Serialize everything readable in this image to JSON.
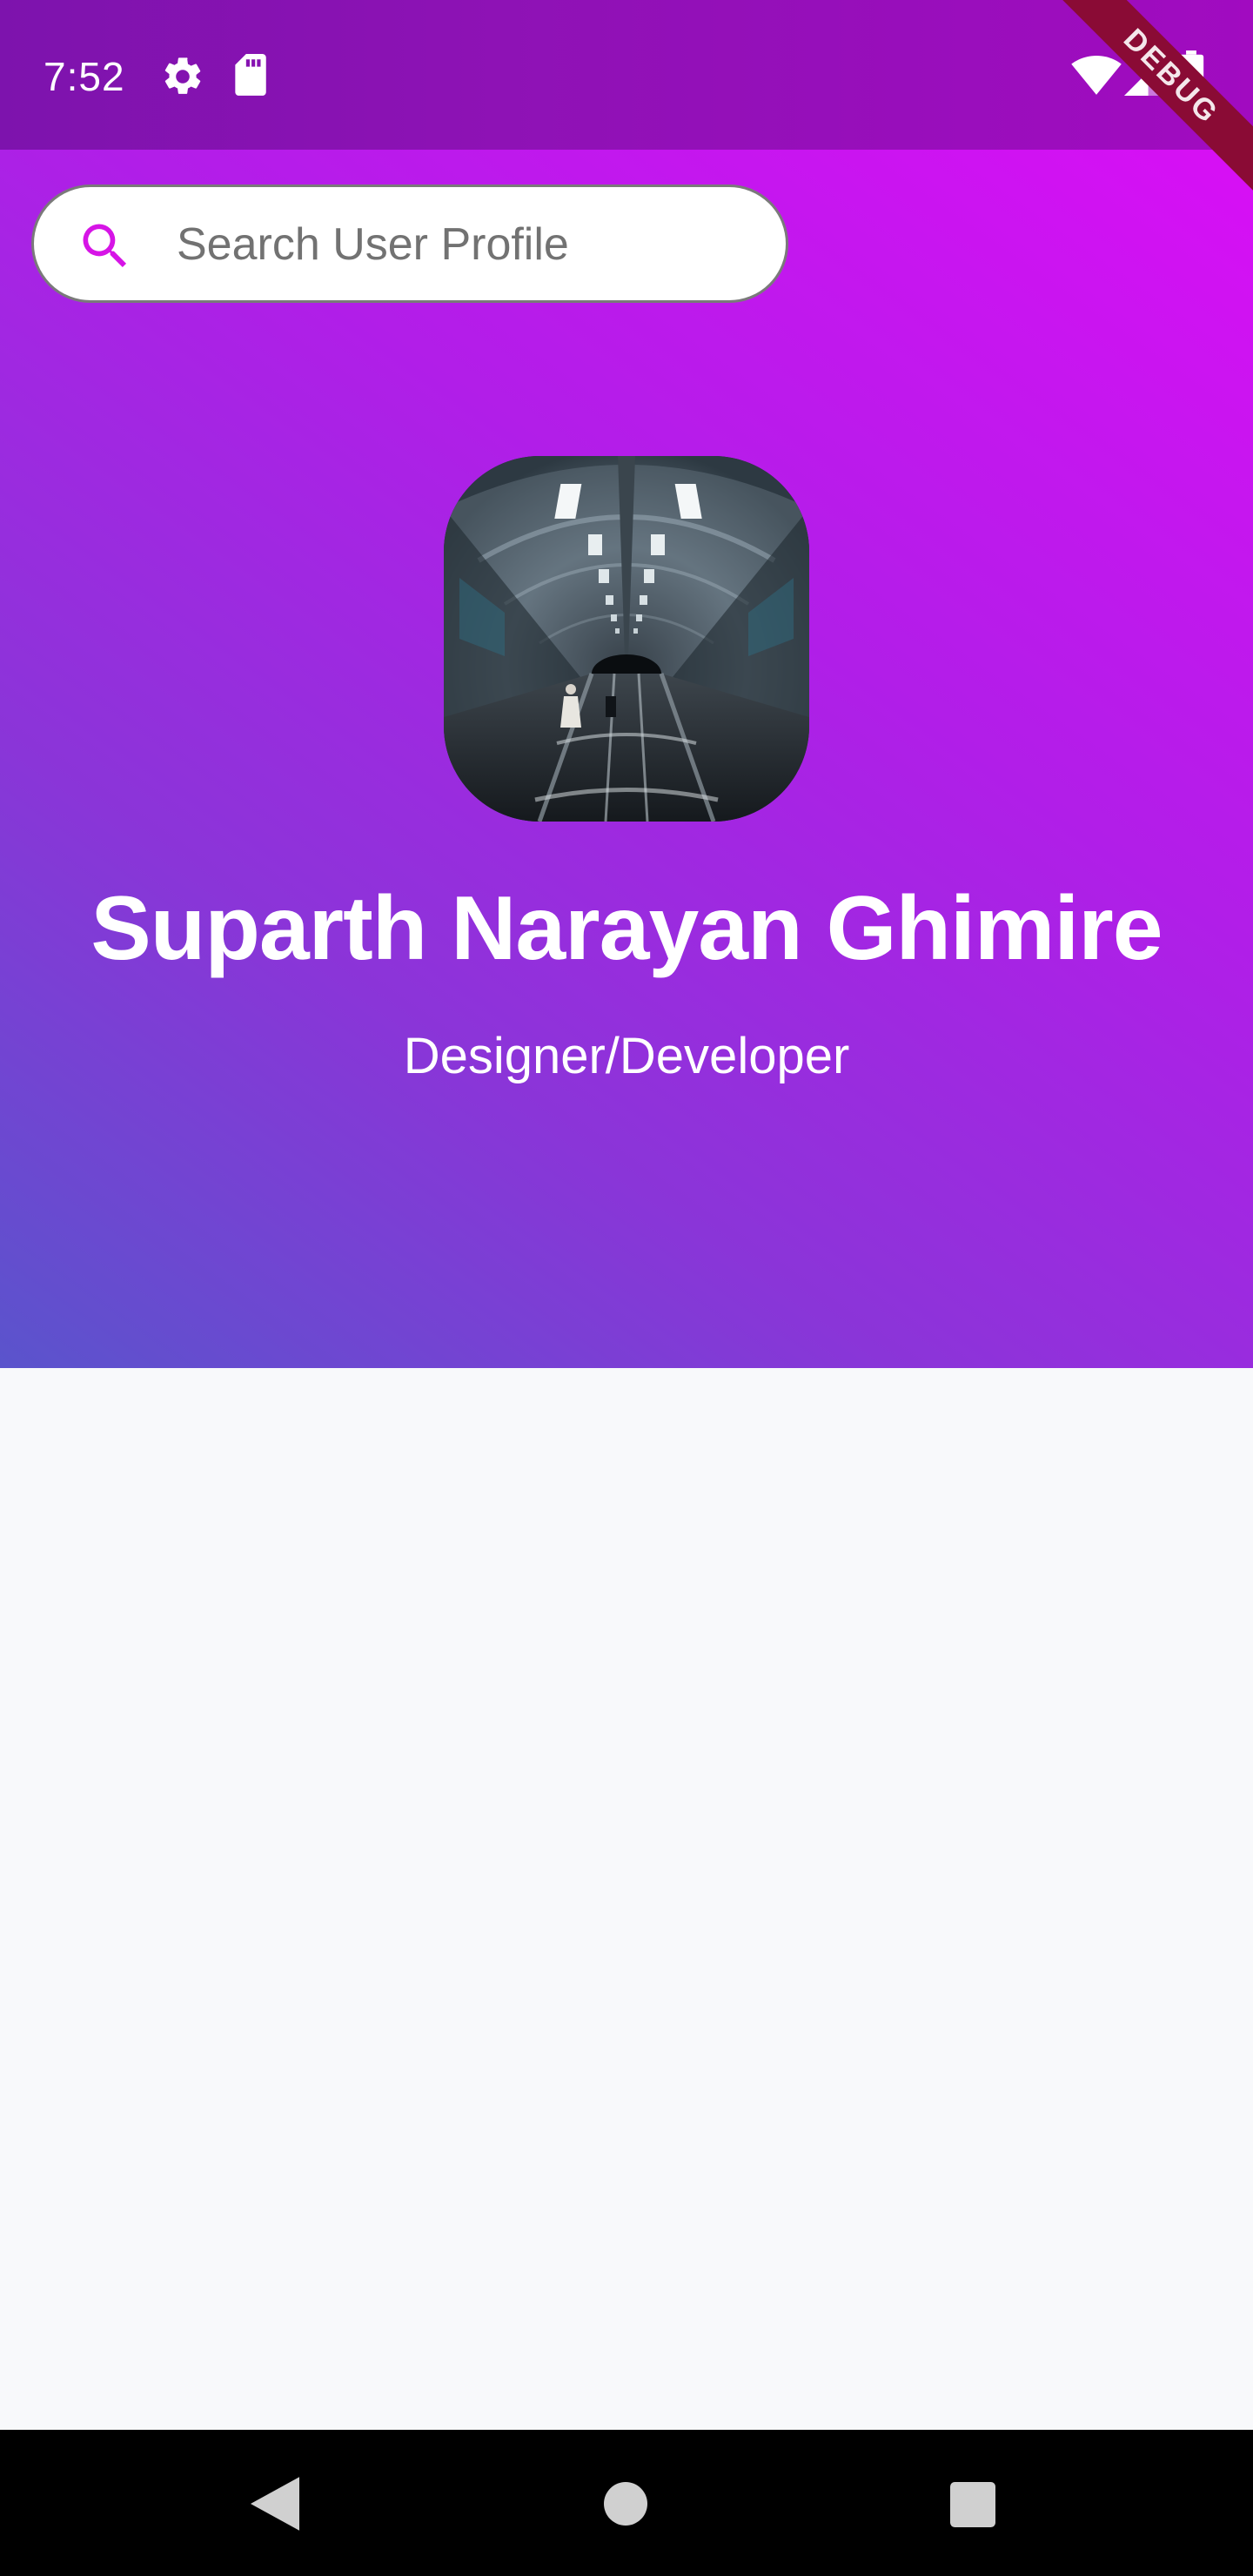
{
  "status_bar": {
    "time": "7:52",
    "icons": [
      "settings-icon",
      "sd-card-icon",
      "wifi-icon",
      "signal-icon",
      "battery-icon"
    ]
  },
  "debug_banner": {
    "label": "DEBUG",
    "color": "#8a0b35"
  },
  "search": {
    "placeholder": "Search User Profile",
    "value": "",
    "icon": "search-icon",
    "icon_color": "#d614e6"
  },
  "profile": {
    "avatar": "tunnel-escalator-photo",
    "name": "Suparth Narayan Ghimire",
    "role": "Designer/Developer"
  },
  "theme": {
    "header_gradient_start": "#5a54cc",
    "header_gradient_end": "#d80ff5",
    "status_bar_color": "#8e12b5",
    "background": "#f8f9fb"
  },
  "nav_bar": {
    "buttons": [
      "back-icon",
      "home-icon",
      "recents-icon"
    ]
  }
}
